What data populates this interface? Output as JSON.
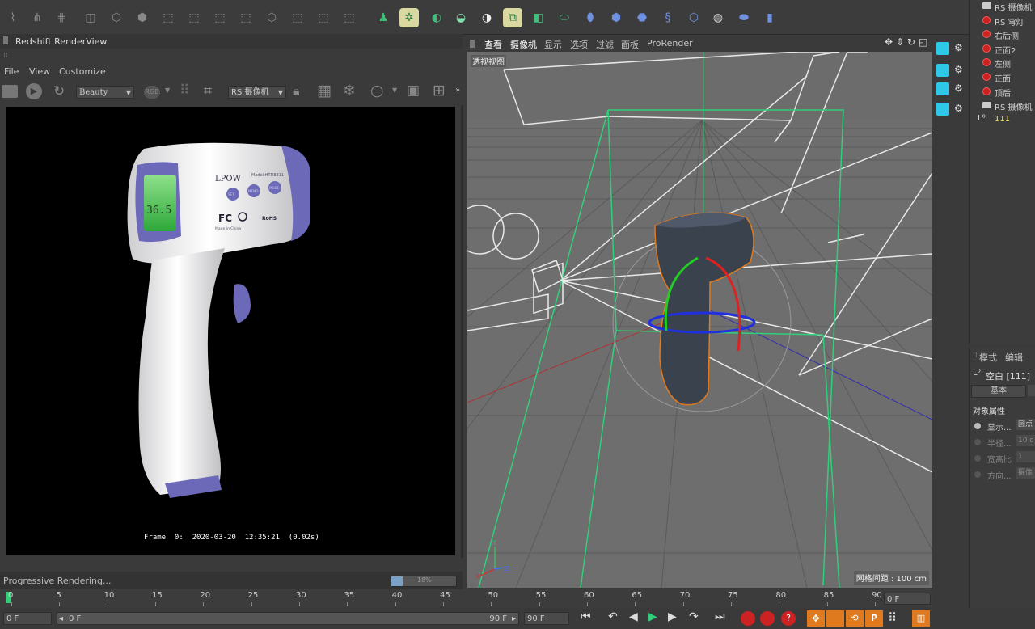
{
  "render_view": {
    "title": "Redshift RenderView",
    "menu": [
      "File",
      "View",
      "Customize"
    ],
    "aov_select": "Beauty",
    "rgb_label": "RGB",
    "camera_select": "RS 摄像机",
    "frame_info": "Frame  0:  2020-03-20  12:35:21  (0.02s)",
    "status_text": "Progressive Rendering...",
    "progress_percent": 18,
    "progress_label": "18%",
    "product_text": {
      "brand": "LPOW",
      "model": "Model:HTD8811",
      "display": "36.5",
      "fc": "FC",
      "made_in": "Made in China",
      "rohs": "RoHS",
      "buttons": [
        "SET",
        "MEMO",
        "MODE"
      ]
    }
  },
  "viewport": {
    "menu": [
      "查看",
      "摄像机",
      "显示",
      "选项",
      "过滤",
      "面板",
      "ProRender"
    ],
    "view_label": "透视视图",
    "grid_spacing": "网格间距 : 100 cm"
  },
  "object_manager": {
    "items": [
      {
        "label": "RS 摄像机",
        "icon": "camera-icon"
      },
      {
        "label": "RS 穹灯",
        "icon": "dome-light-icon"
      },
      {
        "label": "右后侧",
        "icon": "light-icon"
      },
      {
        "label": "正面2",
        "icon": "light-icon"
      },
      {
        "label": "左侧",
        "icon": "light-icon"
      },
      {
        "label": "正面",
        "icon": "light-icon"
      },
      {
        "label": "顶后",
        "icon": "light-icon"
      },
      {
        "label": "RS 摄像机",
        "icon": "camera-icon"
      },
      {
        "label": "111",
        "icon": "null-icon"
      }
    ]
  },
  "attribute_manager": {
    "tabs": [
      "模式",
      "编辑"
    ],
    "object_title": "空白 [111]",
    "basic_tab": "基本",
    "section": "对象属性",
    "fields": [
      {
        "label": "显示...",
        "value": "圆点"
      },
      {
        "label": "半径...",
        "value": "10 c"
      },
      {
        "label": "宽高比",
        "value": "1"
      },
      {
        "label": "方向...",
        "value": "摄像"
      }
    ]
  },
  "timeline": {
    "ticks": [
      "0",
      "5",
      "10",
      "15",
      "20",
      "25",
      "30",
      "35",
      "40",
      "45",
      "50",
      "55",
      "60",
      "65",
      "70",
      "75",
      "80",
      "85",
      "90"
    ],
    "current_frame_right": "0 F",
    "start_frame": "0 F",
    "range_start": "0 F",
    "range_end": "90 F",
    "end_frame": "90 F"
  },
  "colors": {
    "accent_orange": "#e07a1e",
    "selection_yellow": "#f0e060",
    "grid_green": "#2fd07a",
    "bg_dark": "#3a3a3a"
  }
}
